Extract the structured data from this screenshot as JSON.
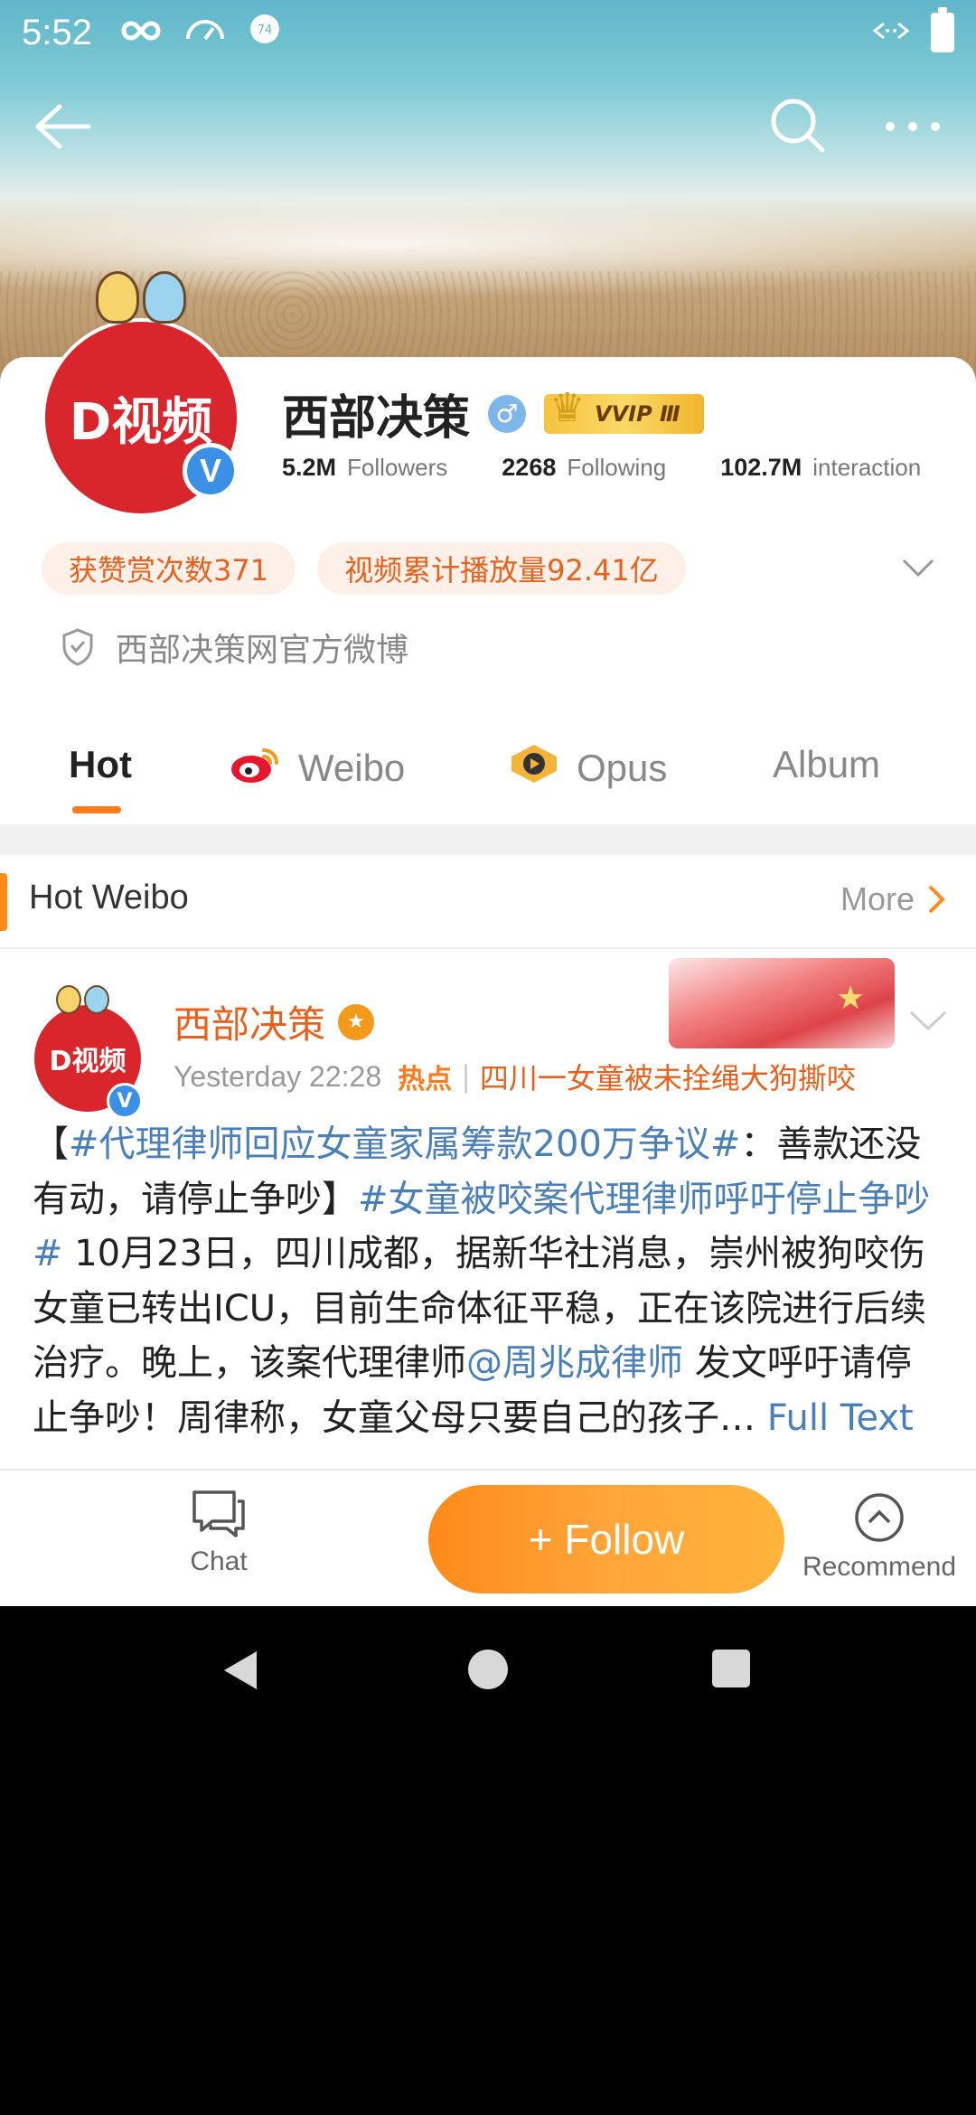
{
  "status_bar": {
    "time": "5:52",
    "icons": [
      "infinity-icon",
      "speedometer-icon",
      "notification-74-icon",
      "data-arrows-icon",
      "battery-icon"
    ],
    "badge_number": "74"
  },
  "top_bar": {
    "icons": [
      "back-arrow-icon",
      "search-icon",
      "more-icon"
    ]
  },
  "profile": {
    "avatar_text": "D视频",
    "name": "西部决策",
    "gender_symbol": "♂",
    "vip_label": "VVIP Ⅲ",
    "verified_mark": "V",
    "stats": [
      {
        "value": "5.2M",
        "label": "Followers"
      },
      {
        "value": "2268",
        "label": "Following"
      },
      {
        "value": "102.7M",
        "label": "interaction"
      }
    ],
    "tags": [
      "获赞赏次数371",
      "视频累计播放量92.41亿"
    ],
    "verification": "西部决策网官方微博"
  },
  "tabs": [
    {
      "label": "Hot",
      "active": true
    },
    {
      "label": "Weibo",
      "active": false
    },
    {
      "label": "Opus",
      "active": false
    },
    {
      "label": "Album",
      "active": false
    }
  ],
  "hot_weibo": {
    "title": "Hot Weibo",
    "more_label": "More"
  },
  "post": {
    "author": "西部决策",
    "avatar_text": "D视频",
    "time": "Yesterday 22:28",
    "hot_label": "热点",
    "topic": "四川一女童被未拴绳大狗撕咬",
    "text_parts": {
      "p1": "【",
      "t1": "#代理律师回应女童家属筹款200万争议#",
      "p2": "：善款还没有动，请停止争吵】",
      "t2": "#女童被咬案代理律师呼吁停止争吵#",
      "p3": " 10月23日，四川成都，据新华社消息，崇州被狗咬伤女童已转出ICU，目前生命体征平稳，正在该院进行后续治疗。晚上，该案代理律师",
      "mention": "@周兆成律师",
      "p4": " 发文呼吁请停止争吵！周律称，女童父母只要自己的孩子… ",
      "full_text": "Full Text"
    }
  },
  "action_bar": {
    "chat_label": "Chat",
    "follow_label": "+ Follow",
    "recommend_label": "Recommend"
  },
  "colors": {
    "accent": "#ff8a1a",
    "brand_red": "#d9262c",
    "link_blue": "#4a7fb8",
    "orange_text": "#e8611c"
  }
}
